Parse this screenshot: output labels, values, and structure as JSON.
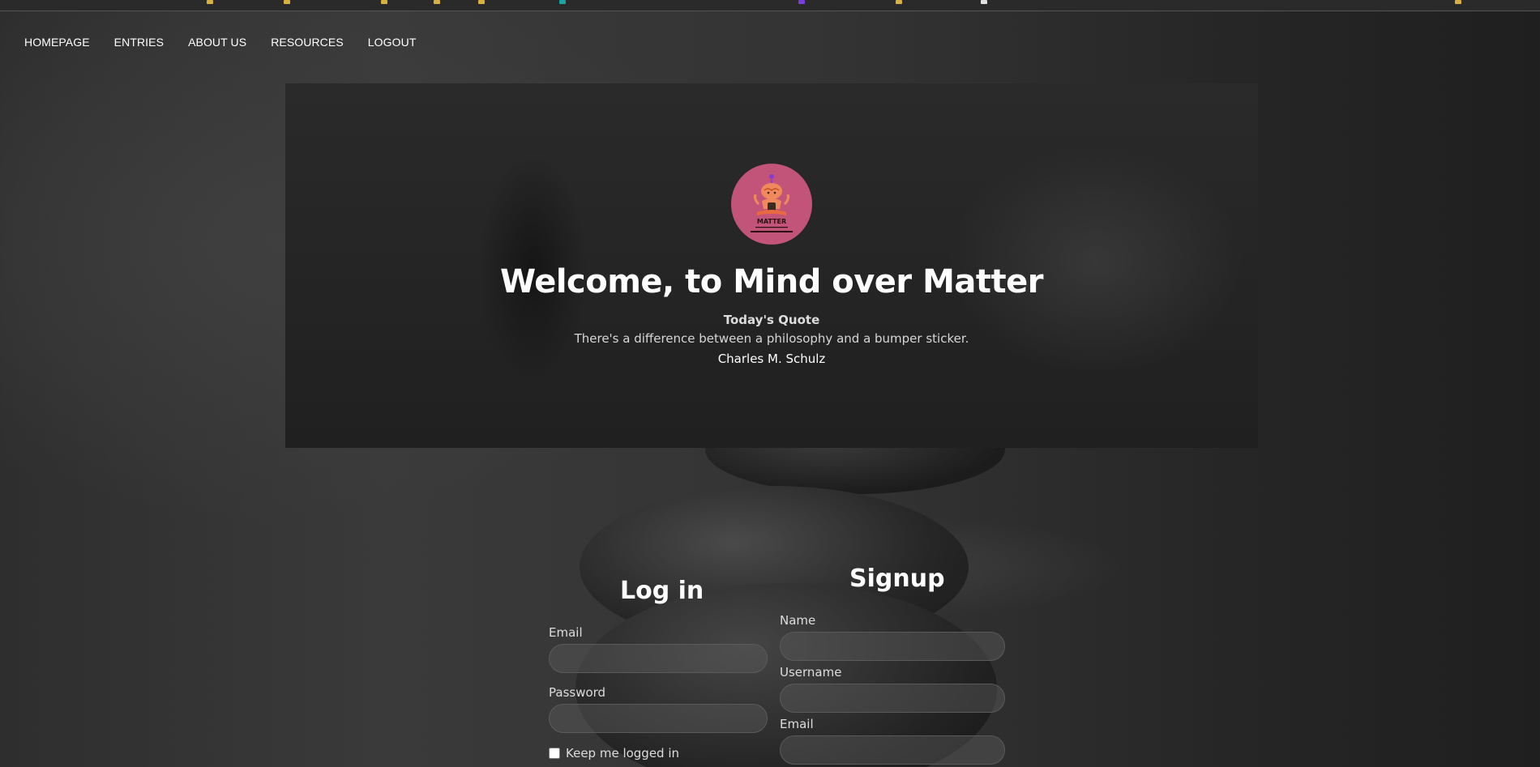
{
  "nav": {
    "items": [
      {
        "label": "HOMEPAGE"
      },
      {
        "label": "ENTRIES"
      },
      {
        "label": "ABOUT US"
      },
      {
        "label": "RESOURCES"
      },
      {
        "label": "LOGOUT"
      }
    ]
  },
  "hero": {
    "logo_icon": "meditating-brain-logo",
    "logo_text": "MATTER",
    "logo_brand_color": "#c25479",
    "title": "Welcome, to Mind over Matter",
    "quote_label": "Today's Quote",
    "quote_text": "There's a difference between a philosophy and a bumper sticker.",
    "quote_author": "Charles M. Schulz"
  },
  "login": {
    "heading": "Log in",
    "email_label": "Email",
    "email_value": "",
    "password_label": "Password",
    "password_value": "",
    "remember_label": "Keep me logged in"
  },
  "signup": {
    "heading": "Signup",
    "name_label": "Name",
    "name_value": "",
    "username_label": "Username",
    "username_value": "",
    "email_label": "Email",
    "email_value": ""
  }
}
